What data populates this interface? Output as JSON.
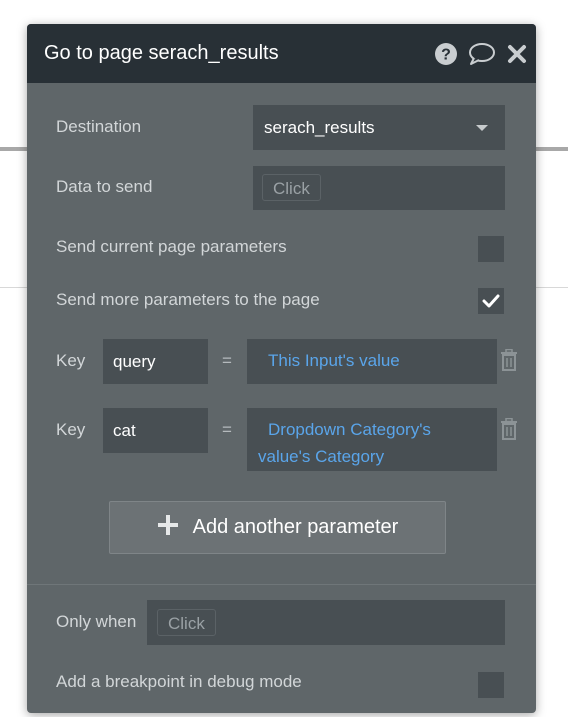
{
  "dialog": {
    "title": "Go to page serach_results",
    "destination": {
      "label": "Destination",
      "value": "serach_results"
    },
    "data_to_send": {
      "label": "Data to send",
      "placeholder": "Click"
    },
    "send_current": {
      "label": "Send current page parameters",
      "checked": false
    },
    "send_more": {
      "label": "Send more parameters to the page",
      "checked": true
    },
    "params": [
      {
        "key_label": "Key",
        "key": "query",
        "eq": "=",
        "value": "This Input's value"
      },
      {
        "key_label": "Key",
        "key": "cat",
        "eq": "=",
        "value_line1": "Dropdown Category's",
        "value_line2": "value's Category"
      }
    ],
    "add_button": "Add another parameter",
    "only_when": {
      "label": "Only when",
      "placeholder": "Click"
    },
    "breakpoint": {
      "label": "Add a breakpoint in debug mode",
      "checked": false
    }
  },
  "icons": [
    "help-icon",
    "comment-icon",
    "close-icon",
    "chevron-down-icon",
    "check-icon",
    "trash-icon",
    "plus-icon"
  ],
  "colors": {
    "title_bar": "#283036",
    "panel": "#5f6669",
    "field": "#484f53",
    "dynamic_text": "#5aa5ea"
  }
}
